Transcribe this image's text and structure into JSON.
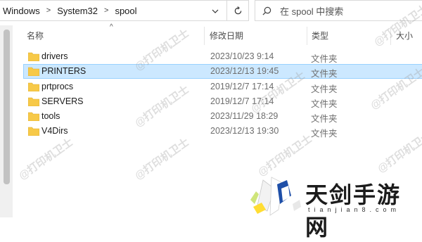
{
  "address": {
    "crumbs": [
      "Windows",
      "System32",
      "spool"
    ]
  },
  "search": {
    "placeholder": "在 spool 中搜索"
  },
  "columns": {
    "name": "名称",
    "date": "修改日期",
    "type": "类型",
    "size": "大小"
  },
  "rows": [
    {
      "name": "drivers",
      "date": "2023/10/23 9:14",
      "type": "文件夹"
    },
    {
      "name": "PRINTERS",
      "date": "2023/12/13 19:45",
      "type": "文件夹",
      "selected": true
    },
    {
      "name": "prtprocs",
      "date": "2019/12/7 17:14",
      "type": "文件夹"
    },
    {
      "name": "SERVERS",
      "date": "2019/12/7 17:14",
      "type": "文件夹"
    },
    {
      "name": "tools",
      "date": "2023/11/29 18:29",
      "type": "文件夹"
    },
    {
      "name": "V4Dirs",
      "date": "2023/12/13 19:30",
      "type": "文件夹"
    }
  ],
  "watermark": "@打印机卫士",
  "logo": {
    "title": "天剑手游网",
    "subtitle": "tianjian8.com"
  },
  "colors": {
    "selection": "#cce8ff",
    "selection_border": "#99d1ff",
    "folder": "#f7c948"
  }
}
